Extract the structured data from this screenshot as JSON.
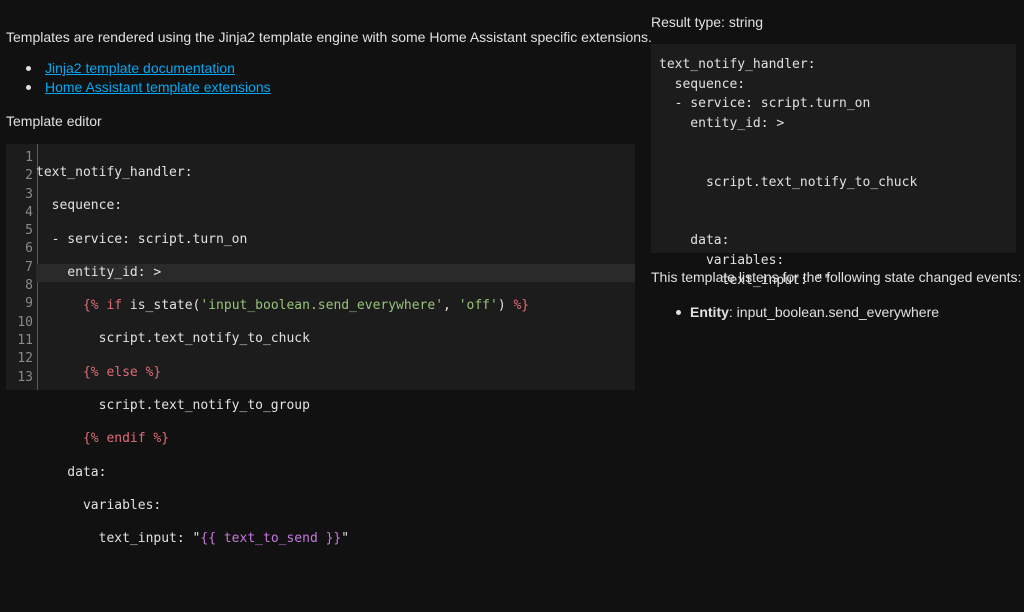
{
  "intro_text": "Templates are rendered using the Jinja2 template engine with some Home Assistant specific extensions.",
  "links": [
    {
      "label": "Jinja2 template documentation"
    },
    {
      "label": "Home Assistant template extensions"
    }
  ],
  "editor": {
    "label": "Template editor",
    "line_numbers": [
      "1",
      "2",
      "3",
      "4",
      "5",
      "6",
      "7",
      "8",
      "9",
      "10",
      "11",
      "12",
      "13"
    ],
    "active_line": 4
  },
  "result": {
    "type_label": "Result type: string",
    "output": "text_notify_handler:\n  sequence:\n  - service: script.turn_on\n    entity_id: >\n\n\n      script.text_notify_to_chuck\n\n\n    data:\n      variables:\n        text_input: \"\""
  },
  "listeners": {
    "heading": "This template listens for the following state changed events:",
    "entity_label": "Entity",
    "entity_value": ": input_boolean.send_everywhere"
  }
}
